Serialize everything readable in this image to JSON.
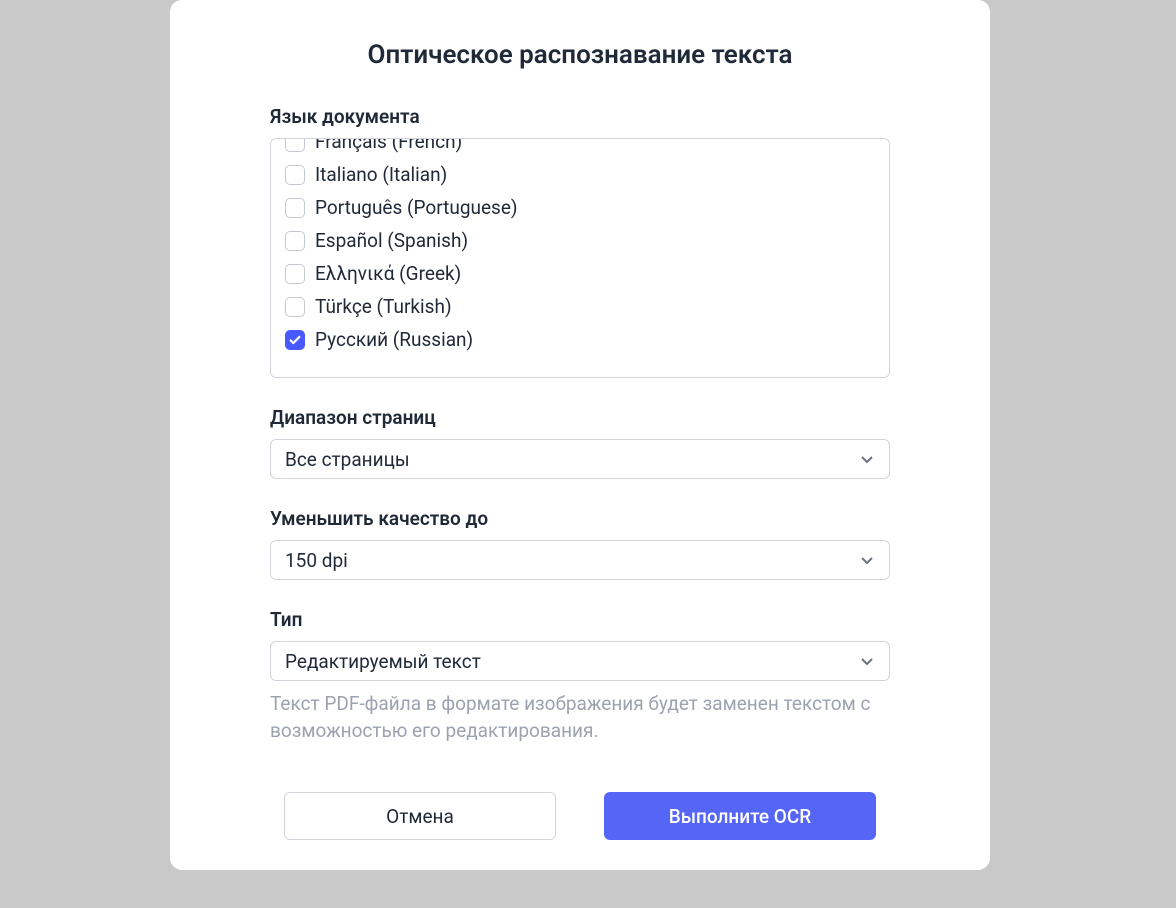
{
  "modal": {
    "title": "Оптическое распознавание текста",
    "document_language": {
      "label": "Язык документа",
      "items": [
        {
          "label": "Français (French)",
          "checked": false
        },
        {
          "label": "Italiano (Italian)",
          "checked": false
        },
        {
          "label": "Português (Portuguese)",
          "checked": false
        },
        {
          "label": "Español (Spanish)",
          "checked": false
        },
        {
          "label": "Ελληνικά (Greek)",
          "checked": false
        },
        {
          "label": "Türkçe (Turkish)",
          "checked": false
        },
        {
          "label": "Русский (Russian)",
          "checked": true
        }
      ]
    },
    "page_range": {
      "label": "Диапазон страниц",
      "value": "Все страницы"
    },
    "quality": {
      "label": "Уменьшить качество до",
      "value": "150 dpi"
    },
    "type": {
      "label": "Тип",
      "value": "Редактируемый текст",
      "description": "Текст PDF-файла в формате изображения будет заменен текстом с возможностью его редактирования."
    },
    "buttons": {
      "cancel": "Отмена",
      "submit": "Выполните OCR"
    }
  }
}
